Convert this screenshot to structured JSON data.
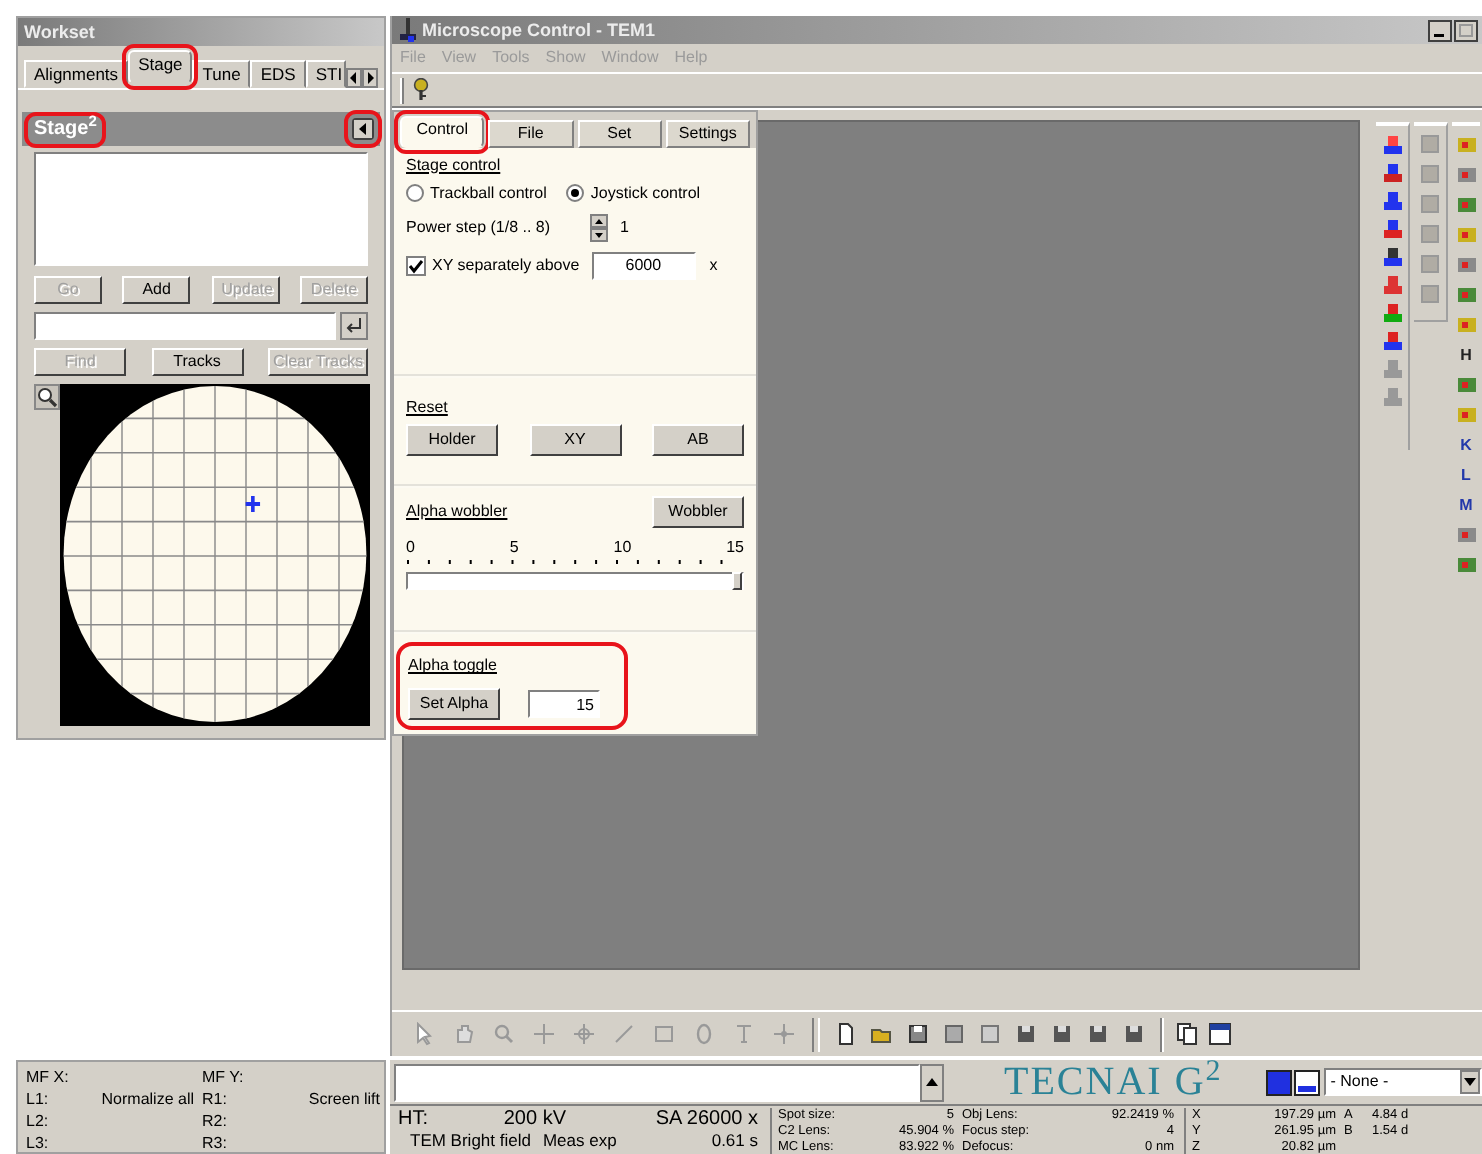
{
  "workset": {
    "title": "Workset",
    "tabs": [
      {
        "label": "Alignments",
        "selected": false,
        "highlighted": false
      },
      {
        "label": "Stage",
        "selected": true,
        "highlighted": true
      },
      {
        "label": "Tune",
        "selected": false,
        "highlighted": false
      },
      {
        "label": "EDS",
        "selected": false,
        "highlighted": false
      },
      {
        "label": "STI",
        "selected": false,
        "highlighted": false
      }
    ],
    "stage_panel": {
      "title": "Stage$^{2}$",
      "highlighted": true,
      "collapse_highlighted": true,
      "buttons": [
        {
          "label": "Go",
          "disabled": true
        },
        {
          "label": "Add",
          "disabled": false
        },
        {
          "label": "Update",
          "disabled": true
        },
        {
          "label": "Delete",
          "disabled": true
        }
      ],
      "track_buttons": [
        {
          "label": "Find",
          "disabled": true
        },
        {
          "label": "Tracks",
          "disabled": false
        },
        {
          "label": "Clear Tracks",
          "disabled": true
        }
      ]
    }
  },
  "microscope_window": {
    "title": "Microscope Control - TEM1",
    "menu": [
      "File",
      "View",
      "Tools",
      "Show",
      "Window",
      "Help"
    ],
    "control_panel": {
      "tabs": [
        {
          "label": "Control",
          "selected": true,
          "highlighted": true
        },
        {
          "label": "File",
          "selected": false,
          "highlighted": false
        },
        {
          "label": "Set",
          "selected": false,
          "highlighted": false
        },
        {
          "label": "Settings",
          "selected": false,
          "highlighted": false
        }
      ],
      "stage_control": {
        "heading": "Stage control",
        "radios": [
          {
            "label": "Trackball control",
            "selected": false
          },
          {
            "label": "Joystick control",
            "selected": true
          }
        ],
        "power_step_label": "Power step (1/8 .. 8)",
        "power_step_value": "1",
        "xy_label": "XY separately above",
        "xy_checked": true,
        "xy_value": "6000",
        "xy_unit": "x"
      },
      "reset": {
        "heading": "Reset",
        "buttons": [
          "Holder",
          "XY",
          "AB"
        ]
      },
      "alpha_wobbler": {
        "heading": "Alpha wobbler",
        "button": "Wobbler",
        "ticks": [
          "0",
          "5",
          "10",
          "15"
        ],
        "level": 1.0
      },
      "alpha_toggle": {
        "heading": "Alpha toggle",
        "button": "Set Alpha",
        "value": "15",
        "highlighted": true
      }
    },
    "right_toolbar_column_3": [
      {
        "kind": "icon"
      },
      {
        "kind": "icon"
      },
      {
        "kind": "icon"
      },
      {
        "kind": "icon"
      },
      {
        "kind": "icon"
      },
      {
        "kind": "icon"
      },
      {
        "kind": "icon"
      },
      {
        "kind": "letter",
        "label": "H"
      },
      {
        "kind": "icon"
      },
      {
        "kind": "icon"
      },
      {
        "kind": "letter",
        "label": "K"
      },
      {
        "kind": "letter",
        "label": "L"
      },
      {
        "kind": "letter",
        "label": "M"
      },
      {
        "kind": "icon"
      },
      {
        "kind": "icon"
      }
    ]
  },
  "status": {
    "mf_rows": [
      {
        "left_label": "MF X:",
        "right_label": "MF Y:"
      },
      {
        "left_label": "L1:",
        "left_value": "Normalize all",
        "right_label": "R1:",
        "right_value": "Screen lift"
      },
      {
        "left_label": "L2:",
        "right_label": "R2:"
      },
      {
        "left_label": "L3:",
        "right_label": "R3:"
      }
    ],
    "brand": "TECNAI G$^{2}$",
    "dropdown": "- None -",
    "ht_rows": [
      [
        "HT:",
        "200 kV",
        "SA 26000 x"
      ],
      [
        "TEM Bright field",
        "Meas exp",
        "0.61 s"
      ]
    ],
    "lens_rows": [
      [
        "Spot size:",
        "5",
        "Obj Lens:",
        "92.2419 %"
      ],
      [
        "C2 Lens:",
        "45.904 %",
        "Focus step:",
        "4"
      ],
      [
        "MC Lens:",
        "83.922 %",
        "Defocus:",
        "0 nm"
      ]
    ],
    "position_rows": [
      [
        "X",
        "197.29 µm",
        "A",
        "4.84 d"
      ],
      [
        "Y",
        "261.95 µm",
        "B",
        "1.54 d"
      ],
      [
        "Z",
        "20.82 µm"
      ]
    ]
  }
}
